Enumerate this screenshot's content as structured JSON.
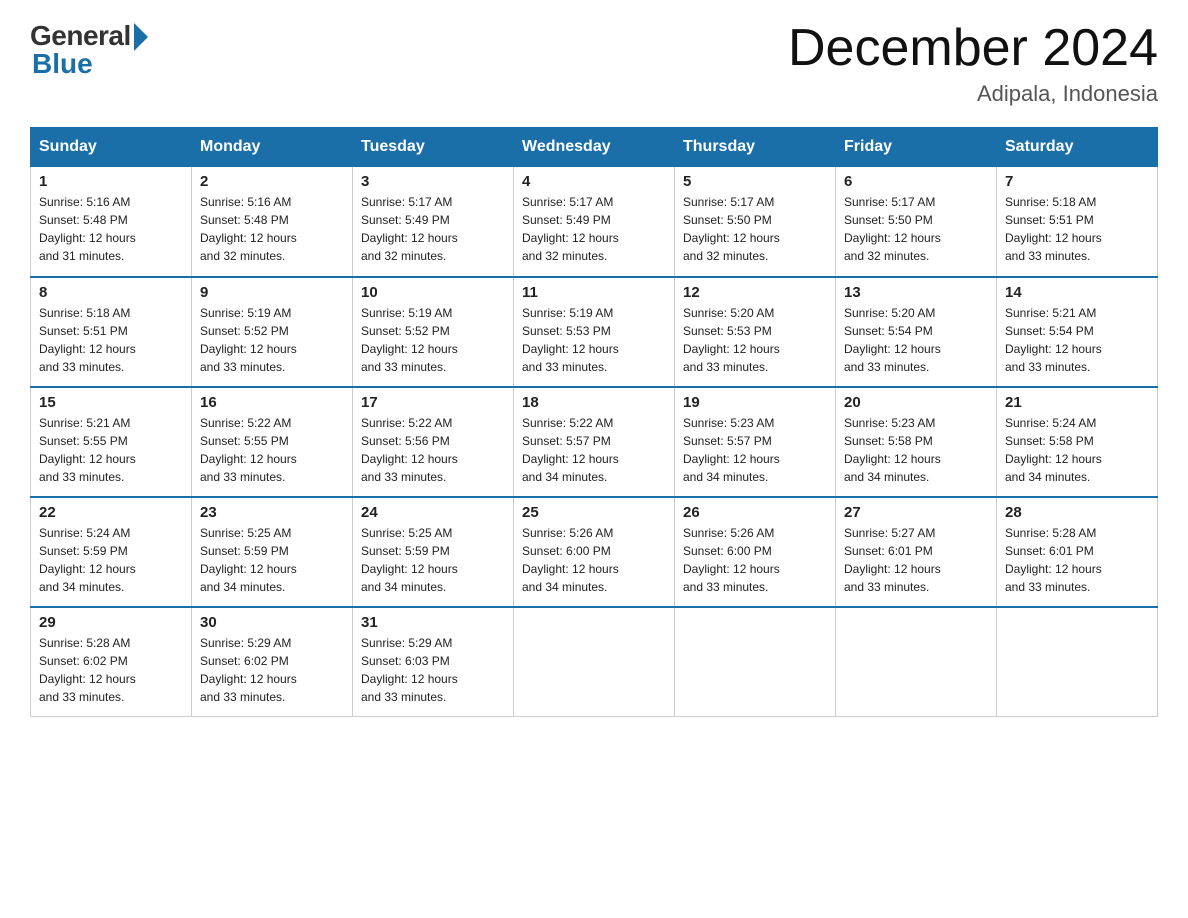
{
  "header": {
    "logo_general": "General",
    "logo_blue": "Blue",
    "month_year": "December 2024",
    "location": "Adipala, Indonesia"
  },
  "days_of_week": [
    "Sunday",
    "Monday",
    "Tuesday",
    "Wednesday",
    "Thursday",
    "Friday",
    "Saturday"
  ],
  "weeks": [
    [
      {
        "day": "1",
        "sunrise": "5:16 AM",
        "sunset": "5:48 PM",
        "daylight": "12 hours and 31 minutes."
      },
      {
        "day": "2",
        "sunrise": "5:16 AM",
        "sunset": "5:48 PM",
        "daylight": "12 hours and 32 minutes."
      },
      {
        "day": "3",
        "sunrise": "5:17 AM",
        "sunset": "5:49 PM",
        "daylight": "12 hours and 32 minutes."
      },
      {
        "day": "4",
        "sunrise": "5:17 AM",
        "sunset": "5:49 PM",
        "daylight": "12 hours and 32 minutes."
      },
      {
        "day": "5",
        "sunrise": "5:17 AM",
        "sunset": "5:50 PM",
        "daylight": "12 hours and 32 minutes."
      },
      {
        "day": "6",
        "sunrise": "5:17 AM",
        "sunset": "5:50 PM",
        "daylight": "12 hours and 32 minutes."
      },
      {
        "day": "7",
        "sunrise": "5:18 AM",
        "sunset": "5:51 PM",
        "daylight": "12 hours and 33 minutes."
      }
    ],
    [
      {
        "day": "8",
        "sunrise": "5:18 AM",
        "sunset": "5:51 PM",
        "daylight": "12 hours and 33 minutes."
      },
      {
        "day": "9",
        "sunrise": "5:19 AM",
        "sunset": "5:52 PM",
        "daylight": "12 hours and 33 minutes."
      },
      {
        "day": "10",
        "sunrise": "5:19 AM",
        "sunset": "5:52 PM",
        "daylight": "12 hours and 33 minutes."
      },
      {
        "day": "11",
        "sunrise": "5:19 AM",
        "sunset": "5:53 PM",
        "daylight": "12 hours and 33 minutes."
      },
      {
        "day": "12",
        "sunrise": "5:20 AM",
        "sunset": "5:53 PM",
        "daylight": "12 hours and 33 minutes."
      },
      {
        "day": "13",
        "sunrise": "5:20 AM",
        "sunset": "5:54 PM",
        "daylight": "12 hours and 33 minutes."
      },
      {
        "day": "14",
        "sunrise": "5:21 AM",
        "sunset": "5:54 PM",
        "daylight": "12 hours and 33 minutes."
      }
    ],
    [
      {
        "day": "15",
        "sunrise": "5:21 AM",
        "sunset": "5:55 PM",
        "daylight": "12 hours and 33 minutes."
      },
      {
        "day": "16",
        "sunrise": "5:22 AM",
        "sunset": "5:55 PM",
        "daylight": "12 hours and 33 minutes."
      },
      {
        "day": "17",
        "sunrise": "5:22 AM",
        "sunset": "5:56 PM",
        "daylight": "12 hours and 33 minutes."
      },
      {
        "day": "18",
        "sunrise": "5:22 AM",
        "sunset": "5:57 PM",
        "daylight": "12 hours and 34 minutes."
      },
      {
        "day": "19",
        "sunrise": "5:23 AM",
        "sunset": "5:57 PM",
        "daylight": "12 hours and 34 minutes."
      },
      {
        "day": "20",
        "sunrise": "5:23 AM",
        "sunset": "5:58 PM",
        "daylight": "12 hours and 34 minutes."
      },
      {
        "day": "21",
        "sunrise": "5:24 AM",
        "sunset": "5:58 PM",
        "daylight": "12 hours and 34 minutes."
      }
    ],
    [
      {
        "day": "22",
        "sunrise": "5:24 AM",
        "sunset": "5:59 PM",
        "daylight": "12 hours and 34 minutes."
      },
      {
        "day": "23",
        "sunrise": "5:25 AM",
        "sunset": "5:59 PM",
        "daylight": "12 hours and 34 minutes."
      },
      {
        "day": "24",
        "sunrise": "5:25 AM",
        "sunset": "5:59 PM",
        "daylight": "12 hours and 34 minutes."
      },
      {
        "day": "25",
        "sunrise": "5:26 AM",
        "sunset": "6:00 PM",
        "daylight": "12 hours and 34 minutes."
      },
      {
        "day": "26",
        "sunrise": "5:26 AM",
        "sunset": "6:00 PM",
        "daylight": "12 hours and 33 minutes."
      },
      {
        "day": "27",
        "sunrise": "5:27 AM",
        "sunset": "6:01 PM",
        "daylight": "12 hours and 33 minutes."
      },
      {
        "day": "28",
        "sunrise": "5:28 AM",
        "sunset": "6:01 PM",
        "daylight": "12 hours and 33 minutes."
      }
    ],
    [
      {
        "day": "29",
        "sunrise": "5:28 AM",
        "sunset": "6:02 PM",
        "daylight": "12 hours and 33 minutes."
      },
      {
        "day": "30",
        "sunrise": "5:29 AM",
        "sunset": "6:02 PM",
        "daylight": "12 hours and 33 minutes."
      },
      {
        "day": "31",
        "sunrise": "5:29 AM",
        "sunset": "6:03 PM",
        "daylight": "12 hours and 33 minutes."
      },
      null,
      null,
      null,
      null
    ]
  ]
}
